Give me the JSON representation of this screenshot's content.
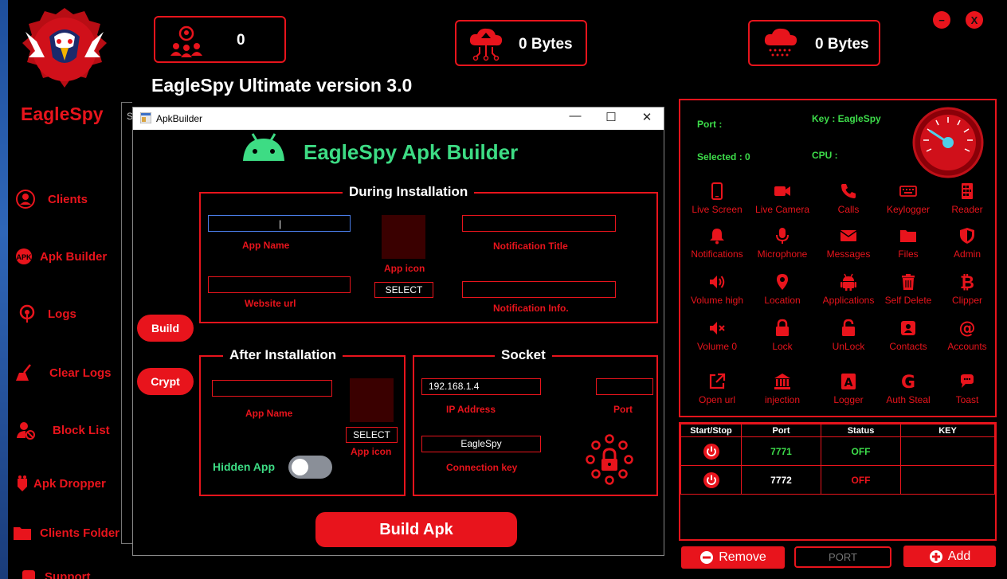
{
  "app": {
    "name": "EagleSpy",
    "title": "EagleSpy Ultimate version 3.0",
    "accent": "#e8141c",
    "green": "#3ddc4a"
  },
  "window_controls": {
    "minimize": "−",
    "close": "X"
  },
  "stats": [
    {
      "icon": "users-network-icon",
      "value": "0"
    },
    {
      "icon": "cloud-upload-icon",
      "value": "0 Bytes"
    },
    {
      "icon": "cloud-download-icon",
      "value": "0 Bytes"
    }
  ],
  "sidebar": {
    "items": [
      {
        "label": "Clients",
        "icon": "user-icon"
      },
      {
        "label": "Apk Builder",
        "icon": "apk-icon"
      },
      {
        "label": "Logs",
        "icon": "logs-icon"
      },
      {
        "label": "Clear Logs",
        "icon": "broom-icon"
      },
      {
        "label": "Block List",
        "icon": "block-user-icon"
      },
      {
        "label": "Apk Dropper",
        "icon": "dropper-icon"
      },
      {
        "label": "Clients Folder",
        "icon": "folder-icon"
      },
      {
        "label": "Support",
        "icon": "support-icon"
      }
    ]
  },
  "panel": {
    "port_label": "Port :",
    "key_label": "Key : EagleSpy",
    "selected_label": "Selected : 0",
    "cpu_label": "CPU :",
    "features": [
      {
        "label": "Live Screen",
        "icon": "phone-icon"
      },
      {
        "label": "Live Camera",
        "icon": "camera-icon"
      },
      {
        "label": "Calls",
        "icon": "call-icon"
      },
      {
        "label": "Keylogger",
        "icon": "keyboard-icon"
      },
      {
        "label": "Reader",
        "icon": "reader-icon"
      },
      {
        "label": "Notifications",
        "icon": "bell-icon"
      },
      {
        "label": "Microphone",
        "icon": "microphone-icon"
      },
      {
        "label": "Messages",
        "icon": "envelope-icon"
      },
      {
        "label": "Files",
        "icon": "folder-icon"
      },
      {
        "label": "Admin",
        "icon": "shield-icon"
      },
      {
        "label": "Volume high",
        "icon": "volume-high-icon"
      },
      {
        "label": "Location",
        "icon": "location-icon"
      },
      {
        "label": "Applications",
        "icon": "android-icon"
      },
      {
        "label": "Self Delete",
        "icon": "trash-icon"
      },
      {
        "label": "Clipper",
        "icon": "bitcoin-icon"
      },
      {
        "label": "Volume 0",
        "icon": "volume-mute-icon"
      },
      {
        "label": "Lock",
        "icon": "lock-icon"
      },
      {
        "label": "UnLock",
        "icon": "unlock-icon"
      },
      {
        "label": "Contacts",
        "icon": "contacts-icon"
      },
      {
        "label": "Accounts",
        "icon": "at-icon"
      },
      {
        "label": "Open url",
        "icon": "external-link-icon"
      },
      {
        "label": "injection",
        "icon": "bank-icon"
      },
      {
        "label": "Logger",
        "icon": "logger-icon"
      },
      {
        "label": "Auth Steal",
        "icon": "google-icon"
      },
      {
        "label": "Toast",
        "icon": "chat-icon"
      }
    ]
  },
  "ports_table": {
    "headers": [
      "Start/Stop",
      "Port",
      "Status",
      "KEY"
    ],
    "rows": [
      {
        "port": "7771",
        "status": "OFF",
        "port_color": "#3ddc4a",
        "status_color": "#3ddc4a"
      },
      {
        "port": "7772",
        "status": "OFF",
        "port_color": "#ffffff",
        "status_color": "#e8141c"
      }
    ]
  },
  "bottom": {
    "remove_label": "Remove",
    "port_placeholder": "PORT",
    "add_label": "Add"
  },
  "behind_dialog_letter": "S",
  "dialog": {
    "window_title": "ApkBuilder",
    "heading": "EagleSpy Apk Builder",
    "during": {
      "title": "During Installation",
      "app_name_label": "App Name",
      "app_icon_label": "App icon",
      "select_label": "SELECT",
      "notification_title_label": "Notification Title",
      "website_url_label": "Website url",
      "notification_info_label": "Notification Info."
    },
    "after": {
      "title": "After Installation",
      "app_name_label": "App Name",
      "app_icon_label": "App icon",
      "select_label": "SELECT",
      "hidden_app_label": "Hidden App"
    },
    "socket": {
      "title": "Socket",
      "ip_value": "192.168.1.4",
      "ip_label": "IP Address",
      "port_label": "Port",
      "key_value": "EagleSpy",
      "key_label": "Connection key"
    },
    "build_label": "Build",
    "crypt_label": "Crypt",
    "build_apk_label": "Build Apk"
  }
}
